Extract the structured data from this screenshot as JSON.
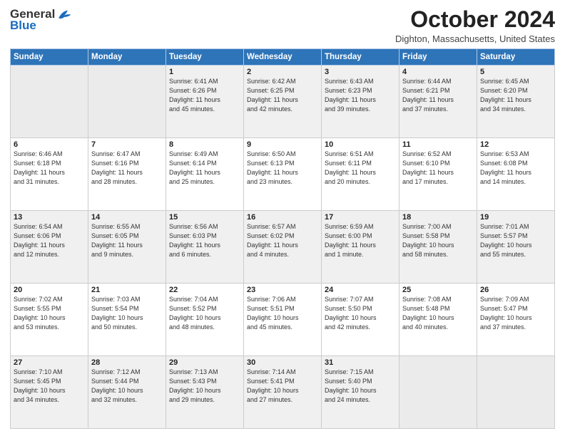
{
  "header": {
    "logo_general": "General",
    "logo_blue": "Blue",
    "month": "October 2024",
    "location": "Dighton, Massachusetts, United States"
  },
  "days_of_week": [
    "Sunday",
    "Monday",
    "Tuesday",
    "Wednesday",
    "Thursday",
    "Friday",
    "Saturday"
  ],
  "weeks": [
    [
      {
        "num": "",
        "info": ""
      },
      {
        "num": "",
        "info": ""
      },
      {
        "num": "1",
        "info": "Sunrise: 6:41 AM\nSunset: 6:26 PM\nDaylight: 11 hours\nand 45 minutes."
      },
      {
        "num": "2",
        "info": "Sunrise: 6:42 AM\nSunset: 6:25 PM\nDaylight: 11 hours\nand 42 minutes."
      },
      {
        "num": "3",
        "info": "Sunrise: 6:43 AM\nSunset: 6:23 PM\nDaylight: 11 hours\nand 39 minutes."
      },
      {
        "num": "4",
        "info": "Sunrise: 6:44 AM\nSunset: 6:21 PM\nDaylight: 11 hours\nand 37 minutes."
      },
      {
        "num": "5",
        "info": "Sunrise: 6:45 AM\nSunset: 6:20 PM\nDaylight: 11 hours\nand 34 minutes."
      }
    ],
    [
      {
        "num": "6",
        "info": "Sunrise: 6:46 AM\nSunset: 6:18 PM\nDaylight: 11 hours\nand 31 minutes."
      },
      {
        "num": "7",
        "info": "Sunrise: 6:47 AM\nSunset: 6:16 PM\nDaylight: 11 hours\nand 28 minutes."
      },
      {
        "num": "8",
        "info": "Sunrise: 6:49 AM\nSunset: 6:14 PM\nDaylight: 11 hours\nand 25 minutes."
      },
      {
        "num": "9",
        "info": "Sunrise: 6:50 AM\nSunset: 6:13 PM\nDaylight: 11 hours\nand 23 minutes."
      },
      {
        "num": "10",
        "info": "Sunrise: 6:51 AM\nSunset: 6:11 PM\nDaylight: 11 hours\nand 20 minutes."
      },
      {
        "num": "11",
        "info": "Sunrise: 6:52 AM\nSunset: 6:10 PM\nDaylight: 11 hours\nand 17 minutes."
      },
      {
        "num": "12",
        "info": "Sunrise: 6:53 AM\nSunset: 6:08 PM\nDaylight: 11 hours\nand 14 minutes."
      }
    ],
    [
      {
        "num": "13",
        "info": "Sunrise: 6:54 AM\nSunset: 6:06 PM\nDaylight: 11 hours\nand 12 minutes."
      },
      {
        "num": "14",
        "info": "Sunrise: 6:55 AM\nSunset: 6:05 PM\nDaylight: 11 hours\nand 9 minutes."
      },
      {
        "num": "15",
        "info": "Sunrise: 6:56 AM\nSunset: 6:03 PM\nDaylight: 11 hours\nand 6 minutes."
      },
      {
        "num": "16",
        "info": "Sunrise: 6:57 AM\nSunset: 6:02 PM\nDaylight: 11 hours\nand 4 minutes."
      },
      {
        "num": "17",
        "info": "Sunrise: 6:59 AM\nSunset: 6:00 PM\nDaylight: 11 hours\nand 1 minute."
      },
      {
        "num": "18",
        "info": "Sunrise: 7:00 AM\nSunset: 5:58 PM\nDaylight: 10 hours\nand 58 minutes."
      },
      {
        "num": "19",
        "info": "Sunrise: 7:01 AM\nSunset: 5:57 PM\nDaylight: 10 hours\nand 55 minutes."
      }
    ],
    [
      {
        "num": "20",
        "info": "Sunrise: 7:02 AM\nSunset: 5:55 PM\nDaylight: 10 hours\nand 53 minutes."
      },
      {
        "num": "21",
        "info": "Sunrise: 7:03 AM\nSunset: 5:54 PM\nDaylight: 10 hours\nand 50 minutes."
      },
      {
        "num": "22",
        "info": "Sunrise: 7:04 AM\nSunset: 5:52 PM\nDaylight: 10 hours\nand 48 minutes."
      },
      {
        "num": "23",
        "info": "Sunrise: 7:06 AM\nSunset: 5:51 PM\nDaylight: 10 hours\nand 45 minutes."
      },
      {
        "num": "24",
        "info": "Sunrise: 7:07 AM\nSunset: 5:50 PM\nDaylight: 10 hours\nand 42 minutes."
      },
      {
        "num": "25",
        "info": "Sunrise: 7:08 AM\nSunset: 5:48 PM\nDaylight: 10 hours\nand 40 minutes."
      },
      {
        "num": "26",
        "info": "Sunrise: 7:09 AM\nSunset: 5:47 PM\nDaylight: 10 hours\nand 37 minutes."
      }
    ],
    [
      {
        "num": "27",
        "info": "Sunrise: 7:10 AM\nSunset: 5:45 PM\nDaylight: 10 hours\nand 34 minutes."
      },
      {
        "num": "28",
        "info": "Sunrise: 7:12 AM\nSunset: 5:44 PM\nDaylight: 10 hours\nand 32 minutes."
      },
      {
        "num": "29",
        "info": "Sunrise: 7:13 AM\nSunset: 5:43 PM\nDaylight: 10 hours\nand 29 minutes."
      },
      {
        "num": "30",
        "info": "Sunrise: 7:14 AM\nSunset: 5:41 PM\nDaylight: 10 hours\nand 27 minutes."
      },
      {
        "num": "31",
        "info": "Sunrise: 7:15 AM\nSunset: 5:40 PM\nDaylight: 10 hours\nand 24 minutes."
      },
      {
        "num": "",
        "info": ""
      },
      {
        "num": "",
        "info": ""
      }
    ]
  ]
}
